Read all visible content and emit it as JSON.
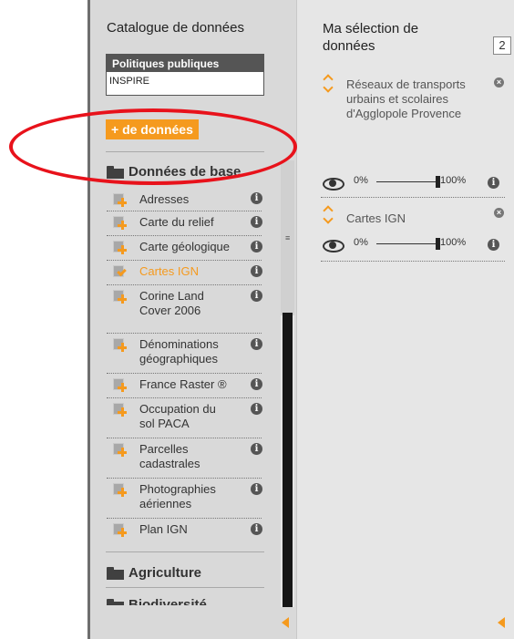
{
  "catalog": {
    "title": "Catalogue de données",
    "filter_header": "Politiques publiques",
    "filter_value": "INSPIRE",
    "more_button": "+ de données",
    "categories": [
      {
        "label": "Données de base"
      },
      {
        "label": "Agriculture"
      },
      {
        "label": "Biodiversité"
      }
    ],
    "items": [
      {
        "label": "Adresses",
        "state": "add"
      },
      {
        "label": "Carte du relief",
        "state": "add"
      },
      {
        "label": "Carte géologique",
        "state": "add"
      },
      {
        "label": "Cartes IGN",
        "state": "selected"
      },
      {
        "label": "Corine Land Cover 2006",
        "state": "add"
      },
      {
        "label": "Dénominations géographiques",
        "state": "add"
      },
      {
        "label": "France Raster ®",
        "state": "add"
      },
      {
        "label": "Occupation du sol PACA",
        "state": "add"
      },
      {
        "label": "Parcelles cadastrales",
        "state": "add"
      },
      {
        "label": "Photographies aériennes",
        "state": "add"
      },
      {
        "label": "Plan IGN",
        "state": "add"
      }
    ],
    "info_glyph": "i"
  },
  "selection": {
    "title": "Ma sélection de données",
    "count": "2",
    "layers": [
      {
        "name": "Réseaux de transports urbains et scolaires d'Agglopole Provence",
        "min_label": "0%",
        "max_label": "100%",
        "opacity": 1.0
      },
      {
        "name": "Cartes IGN",
        "min_label": "0%",
        "max_label": "100%",
        "opacity": 1.0
      }
    ],
    "close_glyph": "×"
  },
  "colors": {
    "accent": "#f59a1e",
    "annotation": "#e8121b",
    "panel_bg": "#d9d9d9",
    "selection_bg": "#e6e6e6"
  },
  "icons": [
    "folder-icon",
    "add-layer-icon",
    "added-layer-icon",
    "info-icon",
    "eye-icon",
    "close-icon",
    "reorder-icon",
    "collapse-arrow-icon"
  ]
}
